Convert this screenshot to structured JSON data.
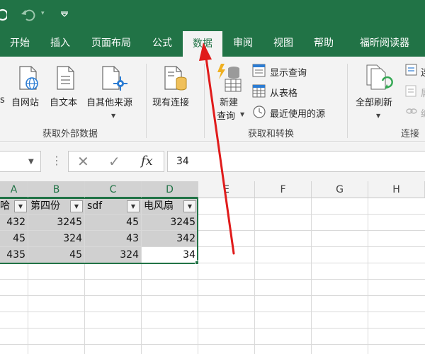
{
  "titlebar": {
    "autosave_icon": "autosave-partial-icon",
    "undo_icon": "undo-icon",
    "undo_caret": "▾",
    "redo_icon": "redo-icon",
    "redo_caret": "▾",
    "customize_icon": "customize-qat-icon"
  },
  "tabs": [
    {
      "label": "开始"
    },
    {
      "label": "插入"
    },
    {
      "label": "页面布局"
    },
    {
      "label": "公式"
    },
    {
      "label": "数据",
      "active": true
    },
    {
      "label": "审阅"
    },
    {
      "label": "视图"
    },
    {
      "label": "帮助"
    },
    {
      "label": "福昕阅读器"
    }
  ],
  "ribbon": {
    "get_external": {
      "partial_label": "s",
      "from_web": "自网站",
      "from_text": "自文本",
      "from_other": "自其他来源",
      "existing": "现有连接",
      "group_label": "获取外部数据"
    },
    "get_transform": {
      "new_query_line1": "新建",
      "new_query_line2": "查询",
      "show_queries": "显示查询",
      "from_table": "从表格",
      "recent_sources": "最近使用的源",
      "group_label": "获取和转换"
    },
    "connections": {
      "refresh_all": "全部刷新",
      "partial_1": "连",
      "partial_2": "属",
      "partial_3": "编",
      "group_label": "连接"
    }
  },
  "formula_bar": {
    "cancel_symbol": "✕",
    "enter_symbol": "✓",
    "fx_symbol": "fx",
    "value": "34"
  },
  "columns": [
    "A",
    "B",
    "C",
    "D",
    "E",
    "F",
    "G",
    "H"
  ],
  "table": {
    "headers": [
      "哈",
      "第四份",
      "sdf",
      "电风扇"
    ],
    "rows": [
      [
        "432",
        "3245",
        "45",
        "3245"
      ],
      [
        "45",
        "324",
        "43",
        "342"
      ],
      [
        "435",
        "45",
        "324",
        "34"
      ]
    ]
  },
  "colors": {
    "accent": "#217346",
    "arrow": "#e01b1b"
  }
}
